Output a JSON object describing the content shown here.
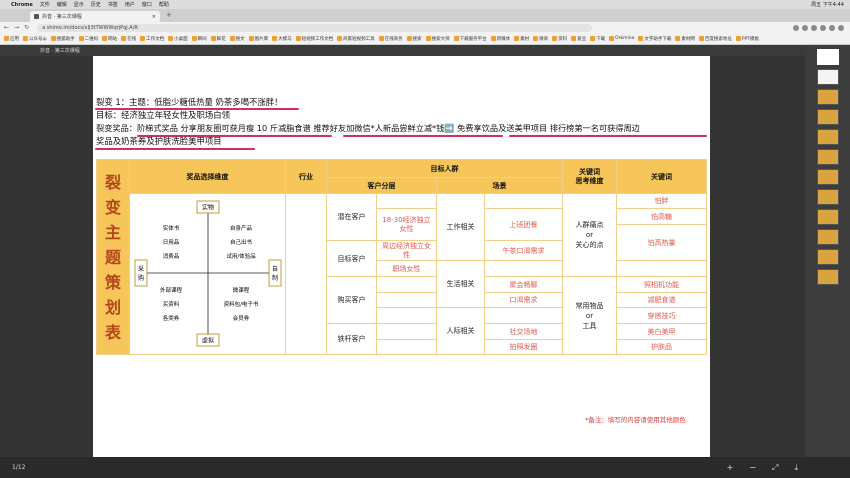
{
  "menubar": {
    "app": "Chrome",
    "items": [
      "文件",
      "编辑",
      "显示",
      "历史",
      "书签",
      "用户",
      "窗口",
      "帮助"
    ],
    "clock": "周五 下午4:44"
  },
  "browser": {
    "tab_title": "抖音 · 第三次课程",
    "url": "a  shimo.im/docs/xIJ3tTWWWqrjPqj.A/R"
  },
  "bookmarks": [
    "应用",
    "公众号ip",
    "搜狐助手",
    "二维码",
    "网站",
    "在线",
    "工作文档",
    "小桌面",
    "瞬间",
    "鲜花",
    "搜文",
    "图片库",
    "大模马",
    "短视频工作文档",
    "商家短视频工具",
    "在线商务",
    "搜索",
    "搜索大师",
    "下载服务平台",
    "新媒体",
    "素材",
    "微商",
    "资料",
    "爱豆",
    "下载",
    "Orkmine",
    "文字助手下载",
    "素材网",
    "百度搜索地址",
    "PPT模板"
  ],
  "viewer": {
    "filename": "抖音 · 第三次课程"
  },
  "doc": {
    "line1": "裂变 1：主题：低脂少糖低热量 奶茶多喝不涨胖！",
    "line2": "目标：经济独立年轻女性及职场白领",
    "line3": "裂变奖品：阶梯式奖品 分享朋友圈可获月瘦 10 斤减脂食谱  推荐好友加微信*人新品尝鲜立减*钱➡️ 免费享饮品及送美甲项目 排行榜第一名可获得周边",
    "line4": "奖品及奶茶券及护肤洗脸美甲项目"
  },
  "table": {
    "vertical_title": [
      "裂",
      "变",
      "主",
      "题",
      "策",
      "划",
      "表"
    ],
    "headers": {
      "prize": "奖品选择维度",
      "industry": "行业",
      "target": "目标人群",
      "segment": "客户分层",
      "scene": "场景",
      "kw_dim": "关键词\n思考维度",
      "kw": "关键词"
    },
    "segments": [
      "潜在客户",
      "目标客户",
      "购买客户",
      "铁杆客户"
    ],
    "segment_details": [
      "18-30经济独立女性",
      "周边经济独立女性",
      "职场女性"
    ],
    "scenes": [
      "工作相关",
      "生活相关",
      "人际相关"
    ],
    "scene_details": [
      "上班团餐",
      "午茶口渴需求",
      "聚会畅聊",
      "口渴需求",
      "社交场地",
      "拍照发圈"
    ],
    "dim1": [
      "人群痛点",
      "or",
      "关心的点"
    ],
    "dim2": [
      "常用物品",
      "or",
      "工具"
    ],
    "keywords": [
      "怕胖",
      "怕高糖",
      "怕高热量",
      "照相机功能",
      "减肥食谱",
      "穿搭技巧",
      "美白美甲",
      "护肤品"
    ]
  },
  "diagram": {
    "top": "实物",
    "bottom": "虚拟",
    "left": "采购",
    "right": "自制",
    "q1": [
      "实体书",
      "日用品",
      "消费品"
    ],
    "q2": [
      "自身产品",
      "自己出书",
      "试用/体验品"
    ],
    "q3": [
      "外部课程",
      "买资料",
      "各类券"
    ],
    "q4": [
      "微课程",
      "资料包/电子书",
      "会员券"
    ]
  },
  "note": "*备注：填写的内容请使用其他颜色",
  "status": {
    "page": "1/12",
    "zoom_out": "−",
    "zoom_in": "+",
    "fit": "⤢",
    "download": "⤓"
  },
  "shield_icon": "shield-icon"
}
